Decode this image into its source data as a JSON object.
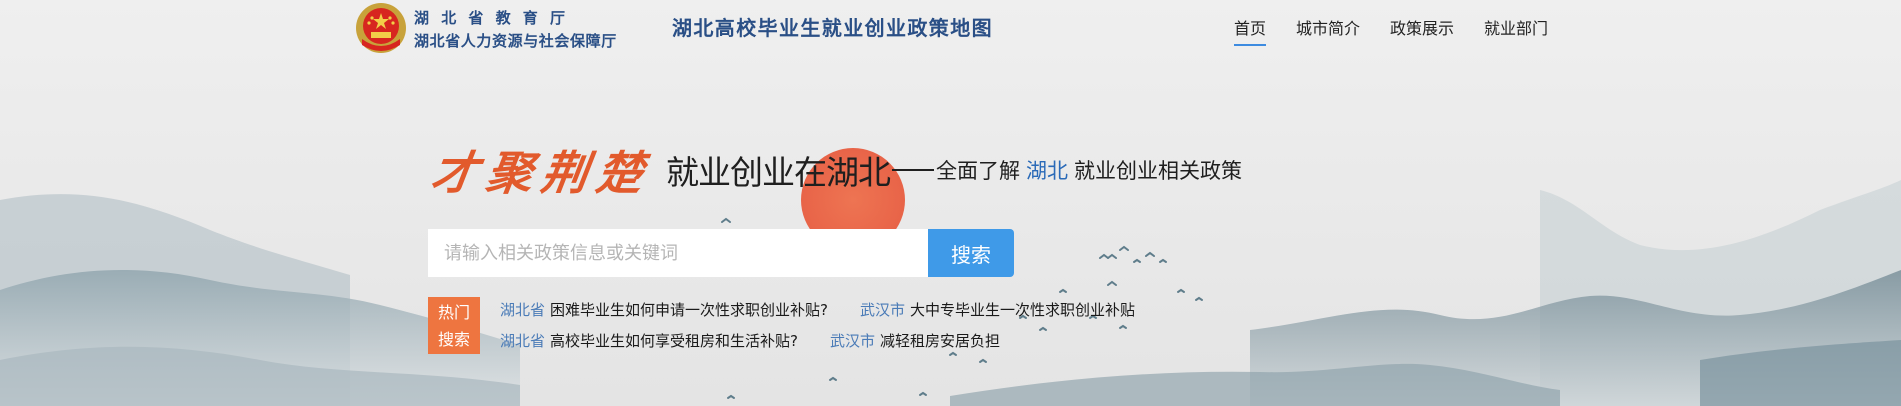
{
  "header": {
    "org_line1": "湖北省教育厅",
    "org_line2": "湖北省人力资源与社会保障厅",
    "site_title": "湖北高校毕业生就业创业政策地图",
    "nav": [
      {
        "label": "首页",
        "active": true
      },
      {
        "label": "城市简介",
        "active": false
      },
      {
        "label": "政策展示",
        "active": false
      },
      {
        "label": "就业部门",
        "active": false
      }
    ]
  },
  "hero": {
    "calligraphy": "才聚荆楚",
    "main_prefix": "就业创业在",
    "main_region": "湖北",
    "sub_prefix": "全面了解",
    "sub_region": "湖北",
    "sub_suffix": "就业创业相关政策"
  },
  "search": {
    "placeholder": "请输入相关政策信息或关键词",
    "button_label": "搜索"
  },
  "hot": {
    "badge_line1": "热门",
    "badge_line2": "搜索",
    "items": [
      {
        "region": "湖北省",
        "text": "困难毕业生如何申请一次性求职创业补贴?"
      },
      {
        "region": "武汉市",
        "text": "大中专毕业生一次性求职创业补贴"
      },
      {
        "region": "湖北省",
        "text": "高校毕业生如何享受租房和生活补贴?"
      },
      {
        "region": "武汉市",
        "text": "减轻租房安居负担"
      }
    ]
  },
  "colors": {
    "brand_blue": "#2a4f86",
    "accent_orange": "#ee7540",
    "search_button": "#3f9ae8",
    "sun": "#e8583a"
  }
}
